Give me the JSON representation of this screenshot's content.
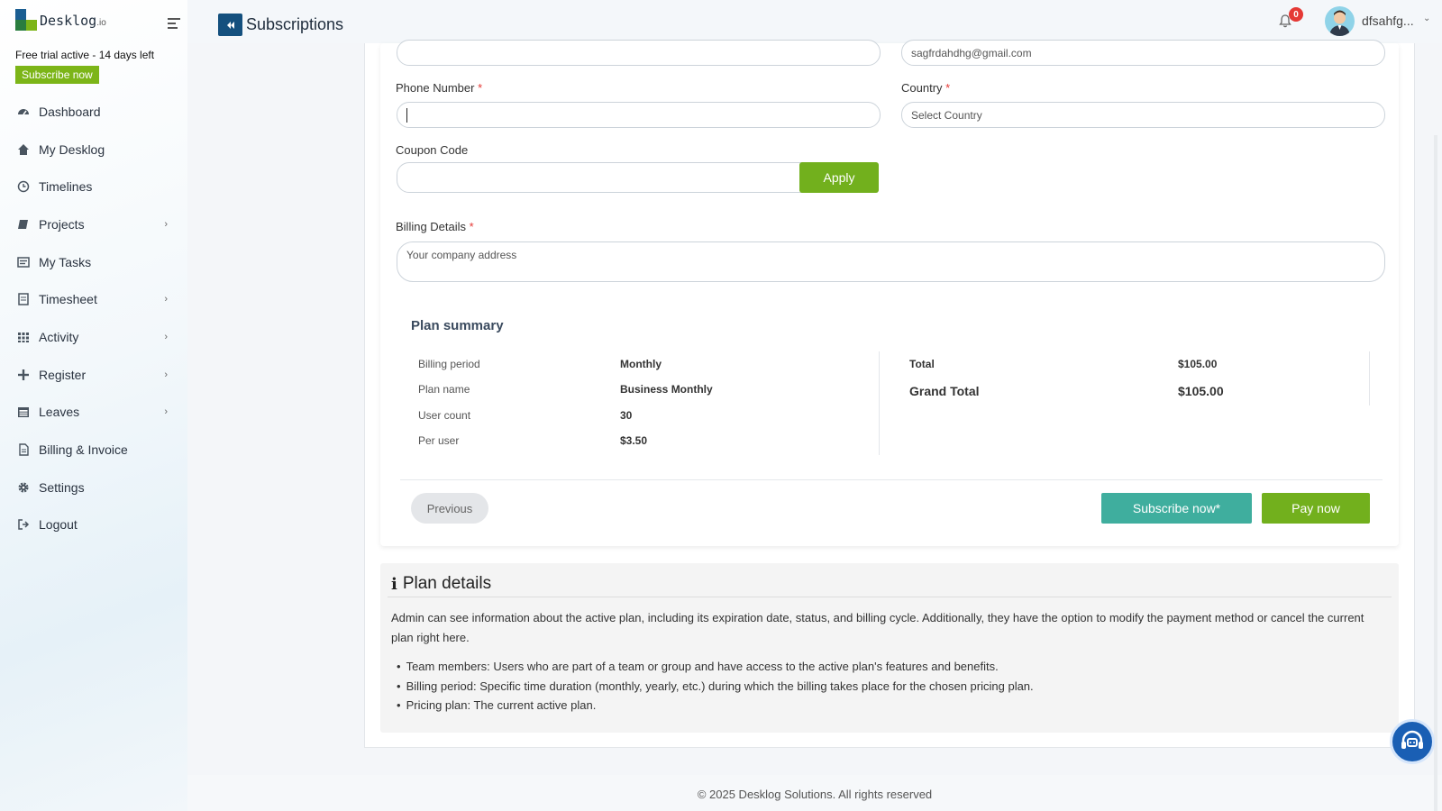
{
  "brand": {
    "name": "Desklog",
    "suffix": ".io"
  },
  "trial": {
    "text": "Free trial active - 14 days left",
    "button": "Subscribe now"
  },
  "nav": [
    {
      "label": "Dashboard",
      "icon": "dashboard-icon",
      "chevron": false
    },
    {
      "label": "My Desklog",
      "icon": "home-icon",
      "chevron": false
    },
    {
      "label": "Timelines",
      "icon": "clock-icon",
      "chevron": false
    },
    {
      "label": "Projects",
      "icon": "book-icon",
      "chevron": true
    },
    {
      "label": "My Tasks",
      "icon": "tasks-icon",
      "chevron": false
    },
    {
      "label": "Timesheet",
      "icon": "timesheet-icon",
      "chevron": true
    },
    {
      "label": "Activity",
      "icon": "grid-icon",
      "chevron": true
    },
    {
      "label": "Register",
      "icon": "plus-icon",
      "chevron": true
    },
    {
      "label": "Leaves",
      "icon": "calendar-icon",
      "chevron": true
    },
    {
      "label": "Billing & Invoice",
      "icon": "invoice-icon",
      "chevron": false
    },
    {
      "label": "Settings",
      "icon": "gear-icon",
      "chevron": false
    },
    {
      "label": "Logout",
      "icon": "logout-icon",
      "chevron": false
    }
  ],
  "header": {
    "title": "Subscriptions",
    "notification_count": "0",
    "user_name": "dfsahfg..."
  },
  "form": {
    "email_value": "sagfrdahdhg@gmail.com",
    "phone_label": "Phone Number",
    "country_label": "Country",
    "country_placeholder": "Select Country",
    "coupon_label": "Coupon Code",
    "apply_button": "Apply",
    "billing_label": "Billing Details",
    "billing_placeholder": "Your company address",
    "required_mark": "*"
  },
  "plan_summary": {
    "title": "Plan summary",
    "rows": [
      {
        "label": "Billing period",
        "value": "Monthly"
      },
      {
        "label": "Plan name",
        "value": "Business Monthly"
      },
      {
        "label": "User count",
        "value": "30"
      },
      {
        "label": "Per user",
        "value": "$3.50"
      }
    ],
    "total_label": "Total",
    "total_value": "$105.00",
    "grand_total_label": "Grand Total",
    "grand_total_value": "$105.00"
  },
  "actions": {
    "previous": "Previous",
    "subscribe": "Subscribe now*",
    "pay": "Pay now"
  },
  "plan_details": {
    "title": "Plan details",
    "description": "Admin can see information about the active plan, including its expiration date, status, and billing cycle. Additionally, they have the option to modify the payment method or cancel the current plan right here.",
    "items": [
      "Team members: Users who are part of a team or group and have access to the active plan's features and benefits.",
      "Billing period: Specific time duration (monthly, yearly, etc.) during which the billing takes place for the chosen pricing plan.",
      "Pricing plan: The current active plan."
    ]
  },
  "footer": "© 2025 Desklog Solutions. All rights reserved",
  "colors": {
    "accent_green": "#72b01d",
    "teal": "#3fae9e",
    "navy": "#14507e",
    "badge_red": "#e53935"
  }
}
